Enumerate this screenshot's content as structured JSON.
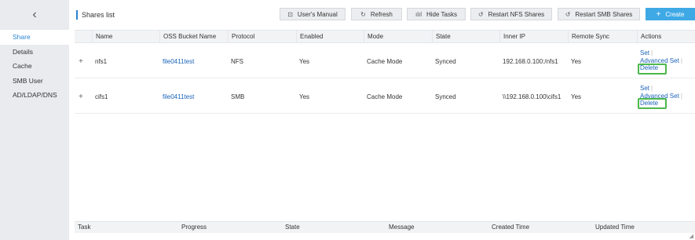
{
  "sidebar": {
    "back_icon": "chevron-left-icon",
    "back_glyph": "‹",
    "items": [
      {
        "label": "Share",
        "active": true
      },
      {
        "label": "Details"
      },
      {
        "label": "Cache"
      },
      {
        "label": "SMB User"
      },
      {
        "label": "AD/LDAP/DNS"
      }
    ]
  },
  "header": {
    "title": "Shares list",
    "buttons": {
      "manual": {
        "label": "User's Manual",
        "icon": "book-icon",
        "glyph": "⊡"
      },
      "refresh": {
        "label": "Refresh",
        "icon": "refresh-icon",
        "glyph": "↻"
      },
      "hide_tasks": {
        "label": "Hide Tasks",
        "icon": "bar-chart-icon",
        "glyph": "ılıl"
      },
      "restart_nfs": {
        "label": "Restart NFS Shares",
        "icon": "restart-icon",
        "glyph": "↺"
      },
      "restart_smb": {
        "label": "Restart SMB Shares",
        "icon": "restart-icon",
        "glyph": "↺"
      },
      "create": {
        "label": "Create",
        "icon": "plus-icon",
        "glyph": "+"
      }
    }
  },
  "table": {
    "columns": [
      "Name",
      "OSS Bucket Name",
      "Protocol",
      "Enabled",
      "Mode",
      "State",
      "Inner IP",
      "Remote Sync",
      "Actions"
    ],
    "rows": [
      {
        "expand": "+",
        "name": "nfs1",
        "bucket": "file0411test",
        "protocol": "NFS",
        "enabled": "Yes",
        "mode": "Cache Mode",
        "state": "Synced",
        "inner_ip": "192.168.0.100:/nfs1",
        "remote_sync": "Yes",
        "actions": {
          "set": "Set",
          "advanced": "Advanced Set",
          "delete": "Delete",
          "sep": "|"
        }
      },
      {
        "expand": "+",
        "name": "cifs1",
        "bucket": "file0411test",
        "protocol": "SMB",
        "enabled": "Yes",
        "mode": "Cache Mode",
        "state": "Synced",
        "inner_ip": "\\\\192.168.0.100\\cifs1",
        "remote_sync": "Yes",
        "actions": {
          "set": "Set",
          "advanced": "Advanced Set",
          "delete": "Delete",
          "sep": "|"
        }
      }
    ]
  },
  "tasks": {
    "columns": [
      "Task",
      "Progress",
      "State",
      "Message",
      "Created Time",
      "Updated Time"
    ]
  },
  "colors": {
    "accent": "#2a84d2",
    "create_button": "#3fa9e6",
    "highlight_box": "#4cb84c",
    "sidebar_bg": "#e9ebef"
  }
}
